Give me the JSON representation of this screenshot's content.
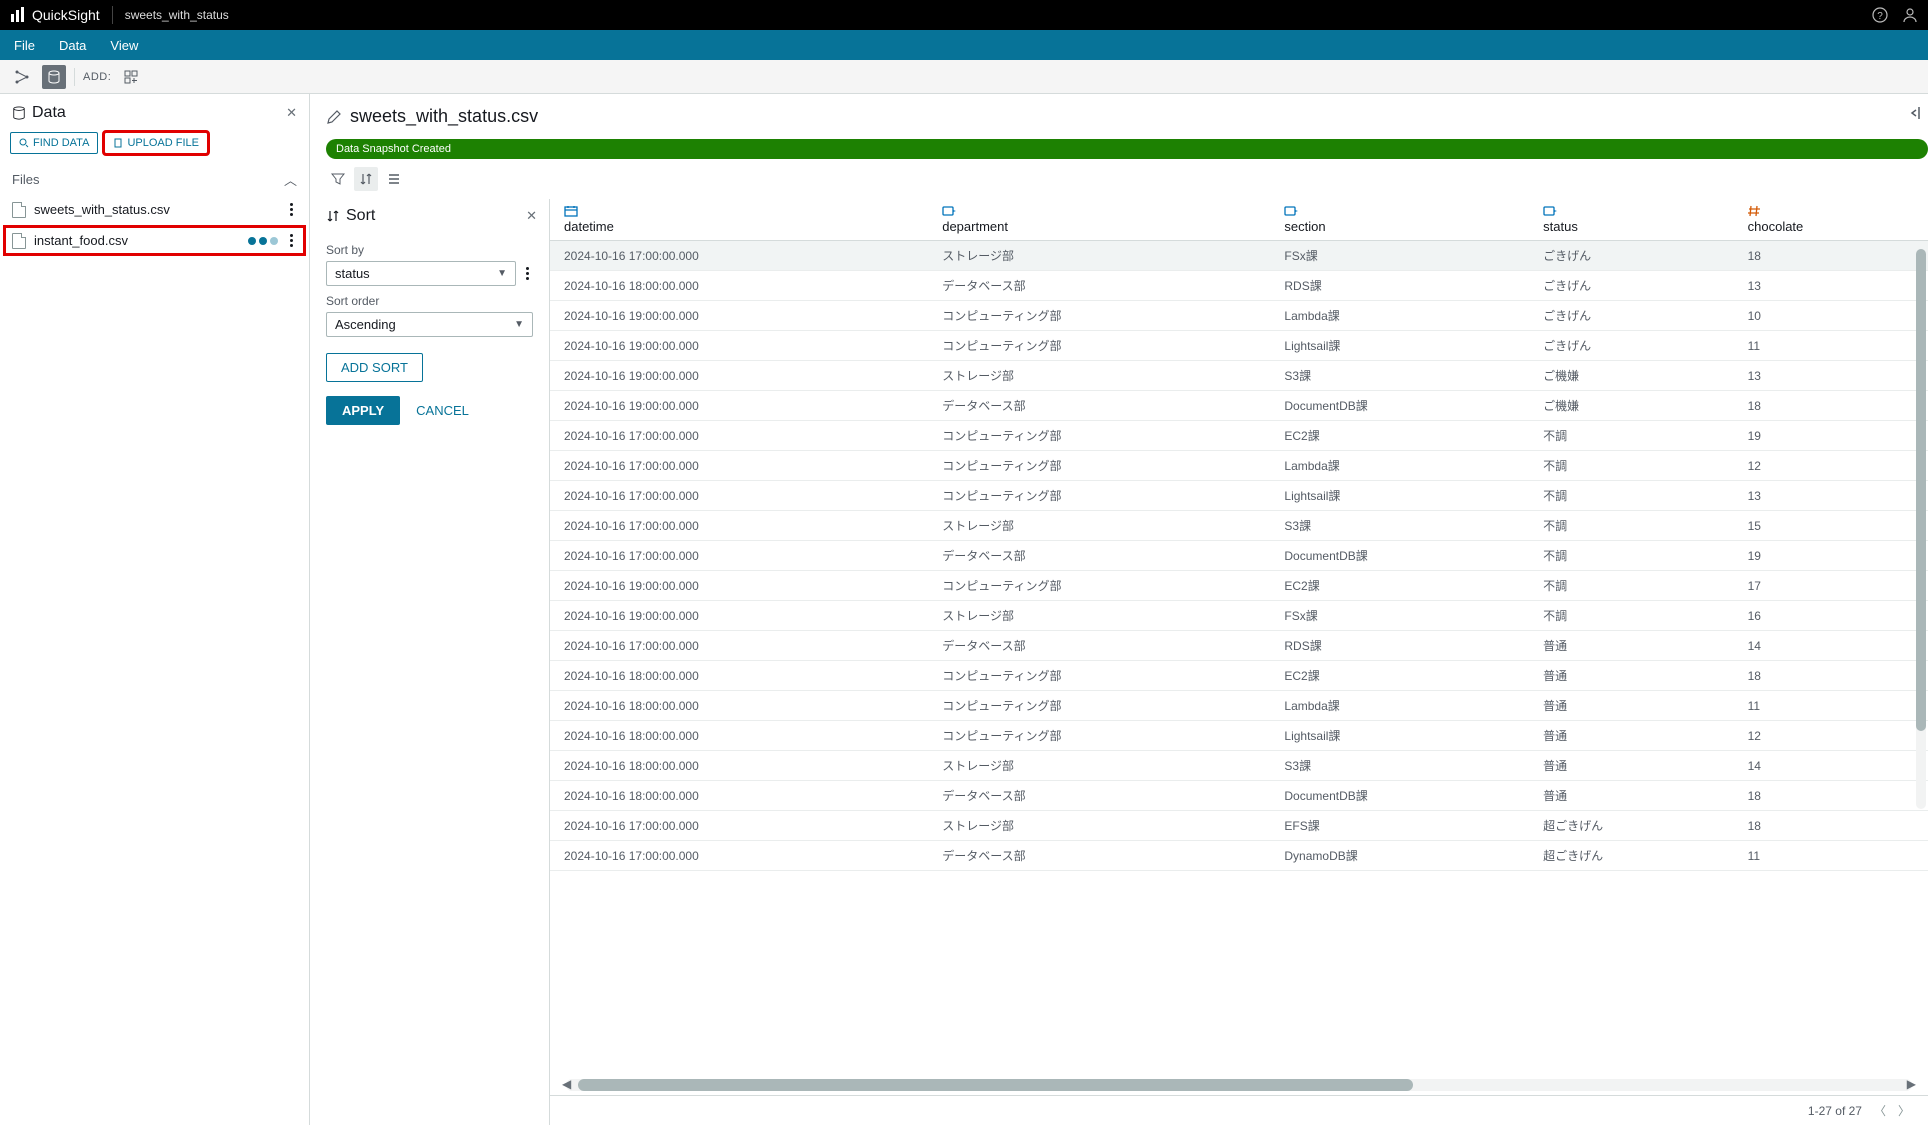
{
  "app": {
    "name": "QuickSight",
    "project": "sweets_with_status"
  },
  "menus": {
    "file": "File",
    "data": "Data",
    "view": "View"
  },
  "toolbar": {
    "add": "ADD:"
  },
  "dataPanel": {
    "title": "Data",
    "findData": "FIND DATA",
    "uploadFile": "UPLOAD FILE",
    "filesHeader": "Files",
    "files": [
      {
        "name": "sweets_with_status.csv",
        "loading": false
      },
      {
        "name": "instant_food.csv",
        "loading": true
      }
    ]
  },
  "main": {
    "filename": "sweets_with_status.csv",
    "snapshotBadge": "Data Snapshot Created"
  },
  "sort": {
    "title": "Sort",
    "sortByLabel": "Sort by",
    "sortByValue": "status",
    "sortOrderLabel": "Sort order",
    "sortOrderValue": "Ascending",
    "addSort": "ADD SORT",
    "apply": "APPLY",
    "cancel": "CANCEL"
  },
  "table": {
    "columns": [
      {
        "name": "datetime",
        "type": "date"
      },
      {
        "name": "department",
        "type": "string"
      },
      {
        "name": "section",
        "type": "string"
      },
      {
        "name": "status",
        "type": "string"
      },
      {
        "name": "chocolate",
        "type": "number"
      }
    ],
    "rows": [
      {
        "datetime": "2024-10-16 17:00:00.000",
        "department": "ストレージ部",
        "section": "FSx課",
        "status": "ごきげん",
        "chocolate": "18"
      },
      {
        "datetime": "2024-10-16 18:00:00.000",
        "department": "データベース部",
        "section": "RDS課",
        "status": "ごきげん",
        "chocolate": "13"
      },
      {
        "datetime": "2024-10-16 19:00:00.000",
        "department": "コンピューティング部",
        "section": "Lambda課",
        "status": "ごきげん",
        "chocolate": "10"
      },
      {
        "datetime": "2024-10-16 19:00:00.000",
        "department": "コンピューティング部",
        "section": "Lightsail課",
        "status": "ごきげん",
        "chocolate": "11"
      },
      {
        "datetime": "2024-10-16 19:00:00.000",
        "department": "ストレージ部",
        "section": "S3課",
        "status": "ご機嫌",
        "chocolate": "13"
      },
      {
        "datetime": "2024-10-16 19:00:00.000",
        "department": "データベース部",
        "section": "DocumentDB課",
        "status": "ご機嫌",
        "chocolate": "18"
      },
      {
        "datetime": "2024-10-16 17:00:00.000",
        "department": "コンピューティング部",
        "section": "EC2課",
        "status": "不調",
        "chocolate": "19"
      },
      {
        "datetime": "2024-10-16 17:00:00.000",
        "department": "コンピューティング部",
        "section": "Lambda課",
        "status": "不調",
        "chocolate": "12"
      },
      {
        "datetime": "2024-10-16 17:00:00.000",
        "department": "コンピューティング部",
        "section": "Lightsail課",
        "status": "不調",
        "chocolate": "13"
      },
      {
        "datetime": "2024-10-16 17:00:00.000",
        "department": "ストレージ部",
        "section": "S3課",
        "status": "不調",
        "chocolate": "15"
      },
      {
        "datetime": "2024-10-16 17:00:00.000",
        "department": "データベース部",
        "section": "DocumentDB課",
        "status": "不調",
        "chocolate": "19"
      },
      {
        "datetime": "2024-10-16 19:00:00.000",
        "department": "コンピューティング部",
        "section": "EC2課",
        "status": "不調",
        "chocolate": "17"
      },
      {
        "datetime": "2024-10-16 19:00:00.000",
        "department": "ストレージ部",
        "section": "FSx課",
        "status": "不調",
        "chocolate": "16"
      },
      {
        "datetime": "2024-10-16 17:00:00.000",
        "department": "データベース部",
        "section": "RDS課",
        "status": "普通",
        "chocolate": "14"
      },
      {
        "datetime": "2024-10-16 18:00:00.000",
        "department": "コンピューティング部",
        "section": "EC2課",
        "status": "普通",
        "chocolate": "18"
      },
      {
        "datetime": "2024-10-16 18:00:00.000",
        "department": "コンピューティング部",
        "section": "Lambda課",
        "status": "普通",
        "chocolate": "11"
      },
      {
        "datetime": "2024-10-16 18:00:00.000",
        "department": "コンピューティング部",
        "section": "Lightsail課",
        "status": "普通",
        "chocolate": "12"
      },
      {
        "datetime": "2024-10-16 18:00:00.000",
        "department": "ストレージ部",
        "section": "S3課",
        "status": "普通",
        "chocolate": "14"
      },
      {
        "datetime": "2024-10-16 18:00:00.000",
        "department": "データベース部",
        "section": "DocumentDB課",
        "status": "普通",
        "chocolate": "18"
      },
      {
        "datetime": "2024-10-16 17:00:00.000",
        "department": "ストレージ部",
        "section": "EFS課",
        "status": "超ごきげん",
        "chocolate": "18"
      },
      {
        "datetime": "2024-10-16 17:00:00.000",
        "department": "データベース部",
        "section": "DynamoDB課",
        "status": "超ごきげん",
        "chocolate": "11"
      }
    ],
    "pagination": "1-27 of 27"
  }
}
